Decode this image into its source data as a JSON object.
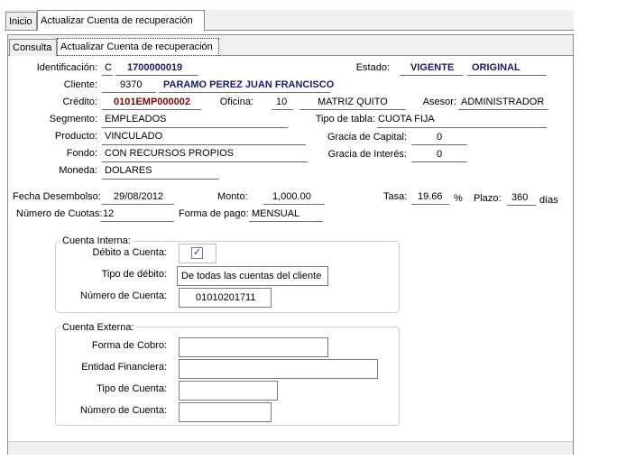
{
  "tabs": {
    "outer": [
      "Inicio",
      "Actualizar Cuenta de recuperación"
    ],
    "inner": [
      "Consulta",
      "Actualizar Cuenta de recuperación"
    ]
  },
  "form": {
    "identificacion_label": "Identificación:",
    "identificacion_tipo": "C",
    "identificacion_num": "1700000019",
    "estado_label": "Estado:",
    "estado_val": "VIGENTE",
    "estado_val2": "ORIGINAL",
    "cliente_label": "Cliente:",
    "cliente_num": "9370",
    "cliente_nombre": "PARAMO PEREZ JUAN FRANCISCO",
    "credito_label": "Crédito:",
    "credito_val": "0101EMP000002",
    "oficina_label": "Oficina:",
    "oficina_num": "10",
    "oficina_nombre": "MATRIZ QUITO",
    "asesor_label": "Asesor:",
    "asesor_val": "ADMINISTRADOR",
    "segmento_label": "Segmento:",
    "segmento_val": "EMPLEADOS",
    "tipo_tabla_label": "Tipo de tabla:",
    "tipo_tabla_val": "CUOTA FIJA",
    "producto_label": "Producto:",
    "producto_val": "VINCULADO",
    "gracia_capital_label": "Gracia de Capital:",
    "gracia_capital_val": "0",
    "fondo_label": "Fondo:",
    "fondo_val": "CON RECURSOS PROPIOS",
    "gracia_interes_label": "Gracia de Interés:",
    "gracia_interes_val": "0",
    "moneda_label": "Moneda:",
    "moneda_val": "DOLARES",
    "fecha_label": "Fecha Desembolso:",
    "fecha_val": "29/08/2012",
    "monto_label": "Monto:",
    "monto_val": "1,000.00",
    "tasa_label": "Tasa:",
    "tasa_val": "19.66",
    "tasa_unit": "%",
    "plazo_label": "Plazo:",
    "plazo_val": "360",
    "plazo_unit": "días",
    "cuotas_label": "Número de Cuotas:",
    "cuotas_val": "12",
    "forma_pago_label": "Forma de pago:",
    "forma_pago_val": "MENSUAL"
  },
  "cuenta_interna": {
    "title": "Cuenta Interna:",
    "debito_label": "Débito a Cuenta:",
    "debito_checked": true,
    "tipo_debito_label": "Tipo de débito:",
    "tipo_debito_val": "De todas las cuentas del cliente",
    "numero_label": "Número de Cuenta:",
    "numero_val": "01010201711"
  },
  "cuenta_externa": {
    "title": "Cuenta Externa:",
    "forma_cobro_label": "Forma de Cobro:",
    "forma_cobro_val": "",
    "entidad_label": "Entidad Financiera:",
    "entidad_val": "",
    "tipo_cuenta_label": "Tipo de Cuenta:",
    "tipo_cuenta_val": "",
    "numero_label": "Número de Cuenta:",
    "numero_val": ""
  }
}
